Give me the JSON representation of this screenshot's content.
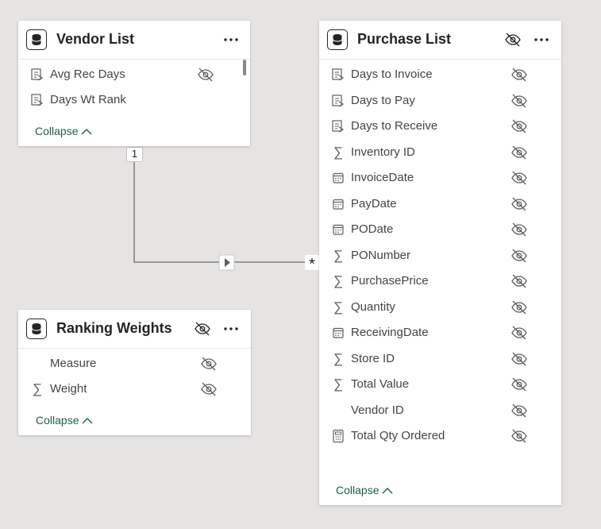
{
  "tables": {
    "vendor_list": {
      "title": "Vendor List",
      "collapse": "Collapse",
      "fields": [
        {
          "label": "Avg Rec Days",
          "icon": "calc-measure-icon",
          "hidden": true
        },
        {
          "label": "Days Wt Rank",
          "icon": "calc-measure-icon",
          "hidden": false
        }
      ]
    },
    "ranking_weights": {
      "title": "Ranking Weights",
      "collapse": "Collapse",
      "fields": [
        {
          "label": "Measure",
          "icon": "none",
          "hidden": true
        },
        {
          "label": "Weight",
          "icon": "sigma-icon",
          "hidden": true
        }
      ]
    },
    "purchase_list": {
      "title": "Purchase List",
      "collapse": "Collapse",
      "fields": [
        {
          "label": "Days to Invoice",
          "icon": "calc-measure-icon",
          "hidden": true
        },
        {
          "label": "Days to Pay",
          "icon": "calc-measure-icon",
          "hidden": true
        },
        {
          "label": "Days to Receive",
          "icon": "calc-measure-icon",
          "hidden": true
        },
        {
          "label": "Inventory ID",
          "icon": "sigma-icon",
          "hidden": true
        },
        {
          "label": "InvoiceDate",
          "icon": "calendar-icon",
          "hidden": true
        },
        {
          "label": "PayDate",
          "icon": "calendar-icon",
          "hidden": true
        },
        {
          "label": "PODate",
          "icon": "calendar-icon",
          "hidden": true
        },
        {
          "label": "PONumber",
          "icon": "sigma-icon",
          "hidden": true
        },
        {
          "label": "PurchasePrice",
          "icon": "sigma-icon",
          "hidden": true
        },
        {
          "label": "Quantity",
          "icon": "sigma-icon",
          "hidden": true
        },
        {
          "label": "ReceivingDate",
          "icon": "calendar-icon",
          "hidden": true
        },
        {
          "label": "Store ID",
          "icon": "sigma-icon",
          "hidden": true
        },
        {
          "label": "Total Value",
          "icon": "sigma-icon",
          "hidden": true
        },
        {
          "label": "Vendor ID",
          "icon": "none",
          "hidden": true
        },
        {
          "label": "Total Qty Ordered",
          "icon": "calculator-icon",
          "hidden": true
        }
      ]
    }
  },
  "relationship": {
    "from_cardinality": "1",
    "to_cardinality": "*"
  },
  "colors": {
    "canvas": "#e5e4e3",
    "card": "#ffffff",
    "collapse_link": "#1d5c4f",
    "connector": "#6b6b6b"
  }
}
